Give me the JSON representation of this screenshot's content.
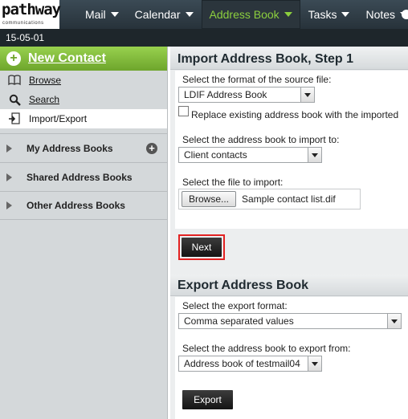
{
  "brand": {
    "name": "pathway",
    "tagline": "communications"
  },
  "nav": {
    "items": [
      {
        "label": "Mail"
      },
      {
        "label": "Calendar"
      },
      {
        "label": "Address Book",
        "active": true
      },
      {
        "label": "Tasks"
      },
      {
        "label": "Notes"
      }
    ]
  },
  "date": "15-05-01",
  "sidebar": {
    "new_contact": "New Contact",
    "links": [
      {
        "label": "Browse",
        "icon": "book-icon"
      },
      {
        "label": "Search",
        "icon": "search-icon"
      },
      {
        "label": "Import/Export",
        "icon": "import-export-icon",
        "selected": true
      }
    ],
    "groups": [
      {
        "label": "My Address Books",
        "has_add": true
      },
      {
        "label": "Shared Address Books"
      },
      {
        "label": "Other Address Books"
      }
    ]
  },
  "import": {
    "title": "Import Address Book, Step 1",
    "format_label": "Select the format of the source file:",
    "format_value": "LDIF Address Book",
    "replace_label": "Replace existing address book with the imported",
    "target_label": "Select the address book to import to:",
    "target_value": "Client contacts",
    "file_label": "Select the file to import:",
    "browse_label": "Browse...",
    "file_name": "Sample contact list.dif",
    "next_label": "Next"
  },
  "export": {
    "title": "Export Address Book",
    "format_label": "Select the export format:",
    "format_value": "Comma separated values",
    "source_label": "Select the address book to export from:",
    "source_value": "Address book of testmail04",
    "export_label": "Export"
  },
  "colors": {
    "accent_green": "#8ccf3e",
    "highlight_red": "#e32222",
    "topbar": "#27323a"
  }
}
